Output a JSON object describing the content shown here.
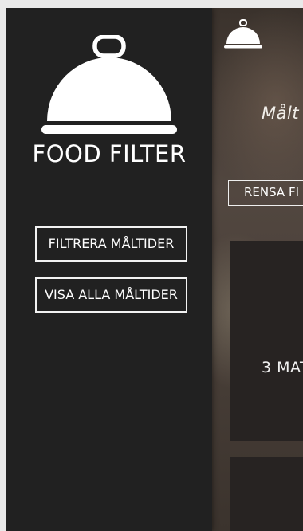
{
  "drawer": {
    "brand": "FOOD FILTER",
    "filter_button": "FILTRERA MÅLTIDER",
    "show_all_button": "VISA ALLA MÅLTIDER"
  },
  "main": {
    "title": "Målt",
    "clear_button": "RENSA FI",
    "card_text": "3 MAT"
  },
  "icons": {
    "logo": "food-cloche-icon"
  },
  "colors": {
    "drawer_bg": "#212121",
    "text": "#ffffff"
  }
}
